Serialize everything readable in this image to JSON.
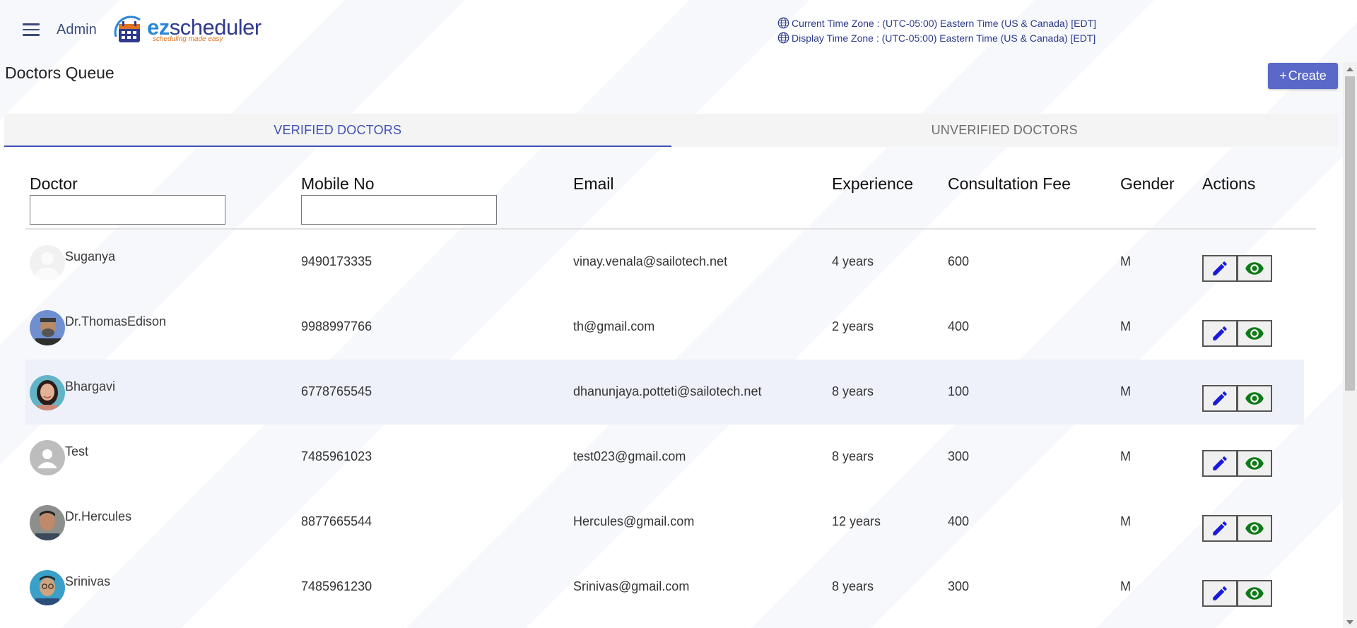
{
  "header": {
    "user_label": "Admin",
    "logo": {
      "ez": "ez",
      "rest": "scheduler",
      "tagline": "scheduling made easy"
    },
    "current_tz": "Current Time Zone : (UTC-05:00) Eastern Time (US & Canada) [EDT]",
    "display_tz": "Display Time Zone : (UTC-05:00) Eastern Time (US & Canada) [EDT]"
  },
  "page": {
    "title": "Doctors Queue",
    "create_label": "Create",
    "create_icon": "+"
  },
  "tabs": [
    {
      "label": "VERIFIED DOCTORS",
      "active": true
    },
    {
      "label": "UNVERIFIED DOCTORS",
      "active": false
    }
  ],
  "table": {
    "columns": [
      "Doctor",
      "Mobile No",
      "Email",
      "Experience",
      "Consultation Fee",
      "Gender",
      "Actions"
    ],
    "filters": {
      "doctor": "",
      "mobile": ""
    },
    "rows": [
      {
        "name": "Suganya",
        "mobile": "9490173335",
        "email": "vinay.venala@sailotech.net",
        "experience": "4 years",
        "fee": "600",
        "gender": "M",
        "avatar": "placeholder-light"
      },
      {
        "name": "Dr.ThomasEdison",
        "mobile": "9988997766",
        "email": "th@gmail.com",
        "experience": "2 years",
        "fee": "400",
        "gender": "M",
        "avatar": "photo-male-beard"
      },
      {
        "name": "Bhargavi",
        "mobile": "6778765545",
        "email": "dhanunjaya.potteti@sailotech.net",
        "experience": "8 years",
        "fee": "100",
        "gender": "M",
        "avatar": "photo-female"
      },
      {
        "name": "Test",
        "mobile": "7485961023",
        "email": "test023@gmail.com",
        "experience": "8 years",
        "fee": "300",
        "gender": "M",
        "avatar": "placeholder-gray"
      },
      {
        "name": "Dr.Hercules",
        "mobile": "8877665544",
        "email": "Hercules@gmail.com",
        "experience": "12 years",
        "fee": "400",
        "gender": "M",
        "avatar": "photo-male"
      },
      {
        "name": "Srinivas",
        "mobile": "7485961230",
        "email": "Srinivas@gmail.com",
        "experience": "8 years",
        "fee": "300",
        "gender": "M",
        "avatar": "photo-male-glasses"
      }
    ]
  },
  "colors": {
    "accent": "#3f51b5",
    "create_button": "#5a68c7",
    "edit_icon": "#1a1adb",
    "view_icon": "#0d7a17",
    "highlight_row": "#eff1fa"
  },
  "icons": {
    "menu": "hamburger-icon",
    "timezone": "globe-icon",
    "edit": "pencil-icon",
    "view": "eye-icon"
  }
}
